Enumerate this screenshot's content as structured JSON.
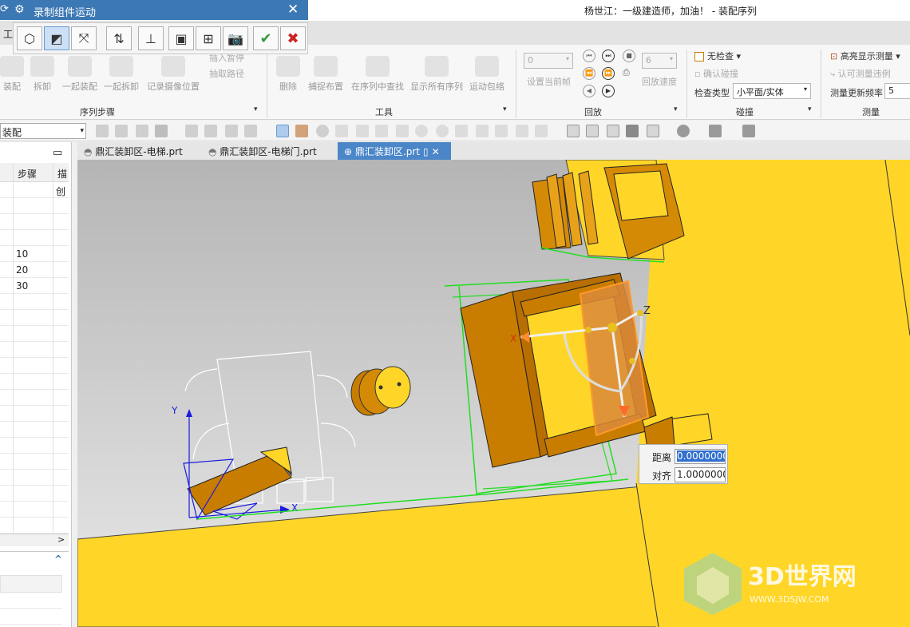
{
  "title_bar": {
    "title": "杨世江：一级建造师，加油！ - 装配序列"
  },
  "record_dialog": {
    "title": "录制组件运动",
    "left_glyph": "⟳",
    "buttons": [
      {
        "name": "move-object-button",
        "glyph": "⬡"
      },
      {
        "name": "move-handles-only-button",
        "glyph": "◩"
      },
      {
        "name": "snap-handle-button",
        "glyph": "⤧"
      },
      {
        "name": "point-to-point-button",
        "glyph": "⇅"
      },
      {
        "name": "csys-align-button",
        "glyph": "⊥"
      },
      {
        "name": "component-preview-button",
        "glyph": "▣"
      },
      {
        "name": "hierarchy-button",
        "glyph": "⊞"
      },
      {
        "name": "snapshot-button",
        "glyph": "📷"
      }
    ],
    "ok_glyph": "✔",
    "cancel_glyph": "✖"
  },
  "ribbon_tab_label": "工",
  "ribbon": {
    "groups": {
      "sequence_steps": "序列步骤",
      "tools": "工具",
      "playback": "回放",
      "collision": "碰撞",
      "measure": "测量"
    },
    "sequence_buttons": [
      "装配",
      "拆卸",
      "一起装配",
      "一起拆卸",
      "记录摄像位置"
    ],
    "sequence_small": [
      "插入暂停",
      "抽取路径"
    ],
    "tool_buttons": [
      "删除",
      "捕捉布置",
      "在序列中查找",
      "显示所有序列",
      "运动包络"
    ],
    "playback": {
      "frame_value": "0",
      "set_frame": "设置当前帧",
      "speed_value": "6",
      "speed_label": "回放速度"
    },
    "collision": {
      "no_check": "无检查",
      "confirm_collision": "确认碰撞",
      "check_type_label": "检查类型",
      "check_type_value": "小平面/实体"
    },
    "measure": {
      "highlight": "高亮显示测量",
      "approve": "认可测量违例",
      "freq_label": "测量更新频率",
      "freq_value": "5"
    }
  },
  "filter_combo": "装配",
  "navigator": {
    "columns": [
      "步骤",
      "描"
    ],
    "first_row_desc": "创",
    "steps": [
      "10",
      "20",
      "30"
    ],
    "collapse_glyph": "^",
    "scroll_glyph": ">"
  },
  "doc_tabs": [
    {
      "label": "鼎汇装卸区-电梯.prt",
      "active": false
    },
    {
      "label": "鼎汇装卸区-电梯门.prt",
      "active": false
    },
    {
      "label": "鼎汇装卸区.prt",
      "active": true
    }
  ],
  "popup": {
    "distance_label": "距离",
    "distance_value": "0.0000000",
    "align_label": "对齐",
    "align_value": "1.0000000"
  },
  "axes": {
    "x": "X",
    "y": "Y",
    "z": "Z"
  },
  "watermark": {
    "brand": "3D世界网",
    "url": "WWW.3DSJW.COM"
  },
  "colors": {
    "accent": "#3c78b4",
    "model_yellow": "#ffd628",
    "model_orange": "#c87d00",
    "select_green": "#22dd22"
  }
}
